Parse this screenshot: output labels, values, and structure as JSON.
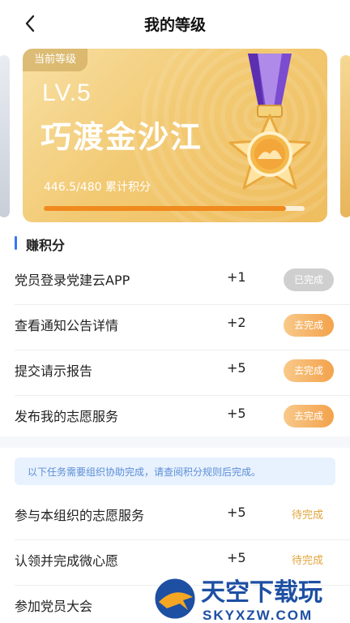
{
  "nav": {
    "title": "我的等级"
  },
  "level_card": {
    "tag": "当前等级",
    "level": "LV.5",
    "level_name": "巧渡金沙江",
    "points_text": "446.5/480 累计积分",
    "progress": 0.93
  },
  "section": {
    "title": "赚积分"
  },
  "tasks": [
    {
      "name": "党员登录党建云APP",
      "points": "+1",
      "status": "已完成"
    },
    {
      "name": "查看通知公告详情",
      "points": "+2",
      "status": "去完成"
    },
    {
      "name": "提交请示报告",
      "points": "+5",
      "status": "去完成"
    },
    {
      "name": "发布我的志愿服务",
      "points": "+5",
      "status": "去完成"
    }
  ],
  "notice": "以下任务需要组织协助完成，请查阅积分规则后完成。",
  "org_tasks": [
    {
      "name": "参与本组织的志愿服务",
      "points": "+5",
      "status": "待完成"
    },
    {
      "name": "认领并完成微心愿",
      "points": "+5",
      "status": "待完成"
    },
    {
      "name": "参加党员大会",
      "points": "",
      "status": ""
    }
  ],
  "watermark": {
    "brand": "天空下载玩",
    "domain": "SKYXZW.COM"
  },
  "colors": {
    "accent_blue": "#3478f6",
    "gold": "#f2ca74",
    "orange": "#f3a24b",
    "done_gray": "#cfcfcf"
  }
}
